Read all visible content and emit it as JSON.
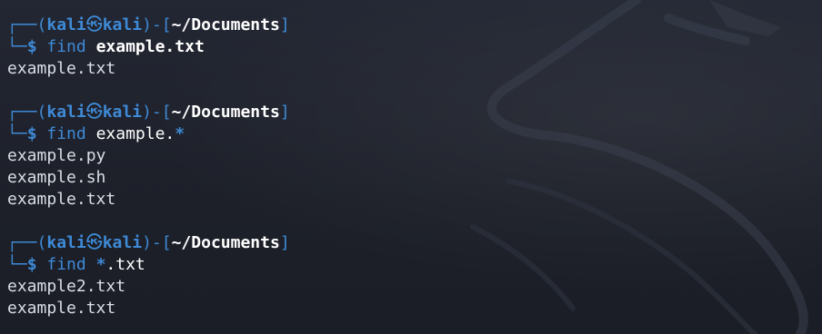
{
  "colors": {
    "background": "#1f232c",
    "prompt_blue": "#3e8ad6",
    "text": "#d8dee6",
    "emphasis": "#ffffff"
  },
  "prompt": {
    "open": "┌──(",
    "user": "kali",
    "at_icon": "㉿",
    "host": "kali",
    "mid": ")-[",
    "dir": "~/Documents",
    "close": "]",
    "second_line_prefix": "└─",
    "dollar": "$"
  },
  "blocks": [
    {
      "command": {
        "name": "find",
        "args": [
          {
            "text": "example.txt",
            "style": "arg-bold"
          }
        ]
      },
      "output": [
        "example.txt"
      ]
    },
    {
      "command": {
        "name": "find",
        "args": [
          {
            "text": "example.",
            "style": "arg"
          },
          {
            "text": "*",
            "style": "glob"
          }
        ]
      },
      "output": [
        "example.py",
        "example.sh",
        "example.txt"
      ]
    },
    {
      "command": {
        "name": "find",
        "args": [
          {
            "text": "*",
            "style": "glob"
          },
          {
            "text": ".txt",
            "style": "arg"
          }
        ]
      },
      "output": [
        "example2.txt",
        "example.txt"
      ]
    }
  ]
}
